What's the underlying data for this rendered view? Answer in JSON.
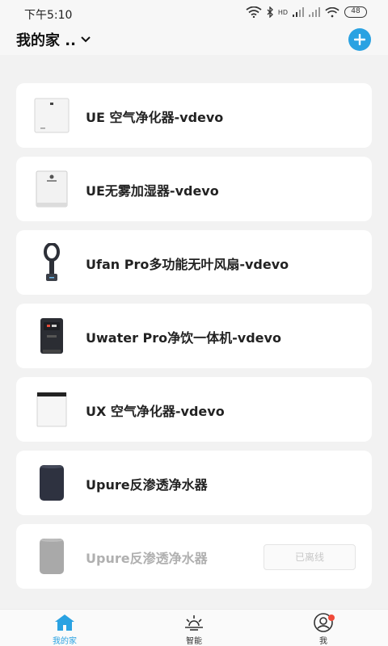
{
  "status_bar": {
    "time": "下午5:10",
    "signal_label": "HD",
    "battery": "48"
  },
  "header": {
    "home_name": "我的家 ..",
    "add_icon": "plus-icon"
  },
  "devices": [
    {
      "name": "UE 空气净化器-vdevo",
      "status": "online",
      "icon": "air-purifier-icon"
    },
    {
      "name": "UE无雾加湿器-vdevo",
      "status": "online",
      "icon": "humidifier-icon"
    },
    {
      "name": "Ufan Pro多功能无叶风扇-vdevo",
      "status": "online",
      "icon": "bladeless-fan-icon"
    },
    {
      "name": "Uwater Pro净饮一体机-vdevo",
      "status": "online",
      "icon": "water-dispenser-icon"
    },
    {
      "name": "UX 空气净化器-vdevo",
      "status": "online",
      "icon": "air-purifier-icon"
    },
    {
      "name": "Upure反渗透净水器",
      "status": "online",
      "icon": "water-purifier-icon"
    },
    {
      "name": "Upure反渗透净水器",
      "status": "offline",
      "icon": "water-purifier-icon",
      "badge": "已离线"
    }
  ],
  "tabs": [
    {
      "label": "我的家",
      "icon": "home-icon",
      "active": true
    },
    {
      "label": "智能",
      "icon": "sun-icon",
      "active": false
    },
    {
      "label": "我",
      "icon": "user-icon",
      "active": false,
      "notification_dot": true
    }
  ],
  "colors": {
    "accent": "#2aa2e2",
    "background": "#f2f2f2",
    "card": "#ffffff",
    "notification": "#f04a3a"
  }
}
